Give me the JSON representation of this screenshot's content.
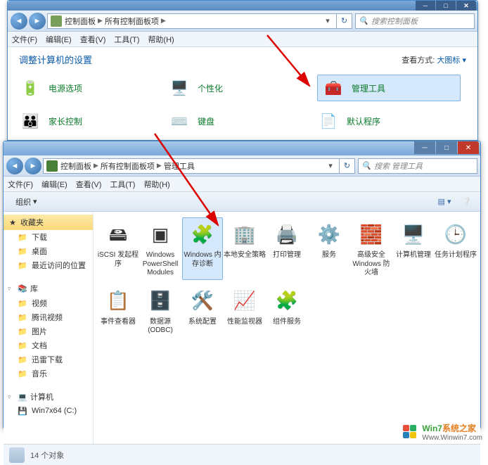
{
  "window1": {
    "breadcrumb": [
      "控制面板",
      "所有控制面板项"
    ],
    "search_placeholder": "搜索控制面板",
    "menus": [
      "文件(F)",
      "编辑(E)",
      "查看(V)",
      "工具(T)",
      "帮助(H)"
    ],
    "title": "调整计算机的设置",
    "view_label": "查看方式:",
    "view_mode": "大图标",
    "items": [
      {
        "label": "电源选项",
        "icon": "🔋",
        "color": "#2a7f2a"
      },
      {
        "label": "个性化",
        "icon": "🖥️",
        "color": "#3a6fa8"
      },
      {
        "label": "管理工具",
        "icon": "🧰",
        "color": "#3a6fa8",
        "highlight": true
      },
      {
        "label": "家长控制",
        "icon": "👪",
        "color": "#e67e22"
      },
      {
        "label": "键盘",
        "icon": "⌨️",
        "color": "#888"
      },
      {
        "label": "默认程序",
        "icon": "📄",
        "color": "#3a6fa8"
      }
    ]
  },
  "window2": {
    "breadcrumb": [
      "控制面板",
      "所有控制面板项",
      "管理工具"
    ],
    "search_placeholder": "搜索 管理工具",
    "menus": [
      "文件(F)",
      "编辑(E)",
      "查看(V)",
      "工具(T)",
      "帮助(H)"
    ],
    "organize": "组织",
    "sidebar": {
      "favorites": {
        "label": "收藏夹",
        "items": [
          "下载",
          "桌面",
          "最近访问的位置"
        ]
      },
      "libraries": {
        "label": "库",
        "items": [
          "视频",
          "腾讯视频",
          "图片",
          "文档",
          "迅雷下载",
          "音乐"
        ]
      },
      "computer": {
        "label": "计算机",
        "items": [
          "Win7x64 (C:)"
        ]
      }
    },
    "tools_row1": [
      {
        "label": "iSCSI 发起程序",
        "icon": "🖴"
      },
      {
        "label": "Windows PowerShell Modules",
        "icon": "▣"
      },
      {
        "label": "Windows 内存诊断",
        "icon": "🧩",
        "selected": true
      },
      {
        "label": "本地安全策略",
        "icon": "🏢"
      },
      {
        "label": "打印管理",
        "icon": "🖨️"
      },
      {
        "label": "服务",
        "icon": "⚙️"
      },
      {
        "label": "高级安全 Windows 防火墙",
        "icon": "🧱"
      },
      {
        "label": "计算机管理",
        "icon": "🖥️"
      },
      {
        "label": "任务计划程序",
        "icon": "🕒"
      }
    ],
    "tools_row2": [
      {
        "label": "事件查看器",
        "icon": "📋"
      },
      {
        "label": "数据源 (ODBC)",
        "icon": "🗄️"
      },
      {
        "label": "系统配置",
        "icon": "🛠️"
      },
      {
        "label": "性能监视器",
        "icon": "📈"
      },
      {
        "label": "组件服务",
        "icon": "🧩"
      }
    ],
    "status": "14 个对象"
  },
  "watermark": {
    "title_prefix": "Win7",
    "title_suffix": "系统之家",
    "url": "Www.Winwin7.com"
  }
}
